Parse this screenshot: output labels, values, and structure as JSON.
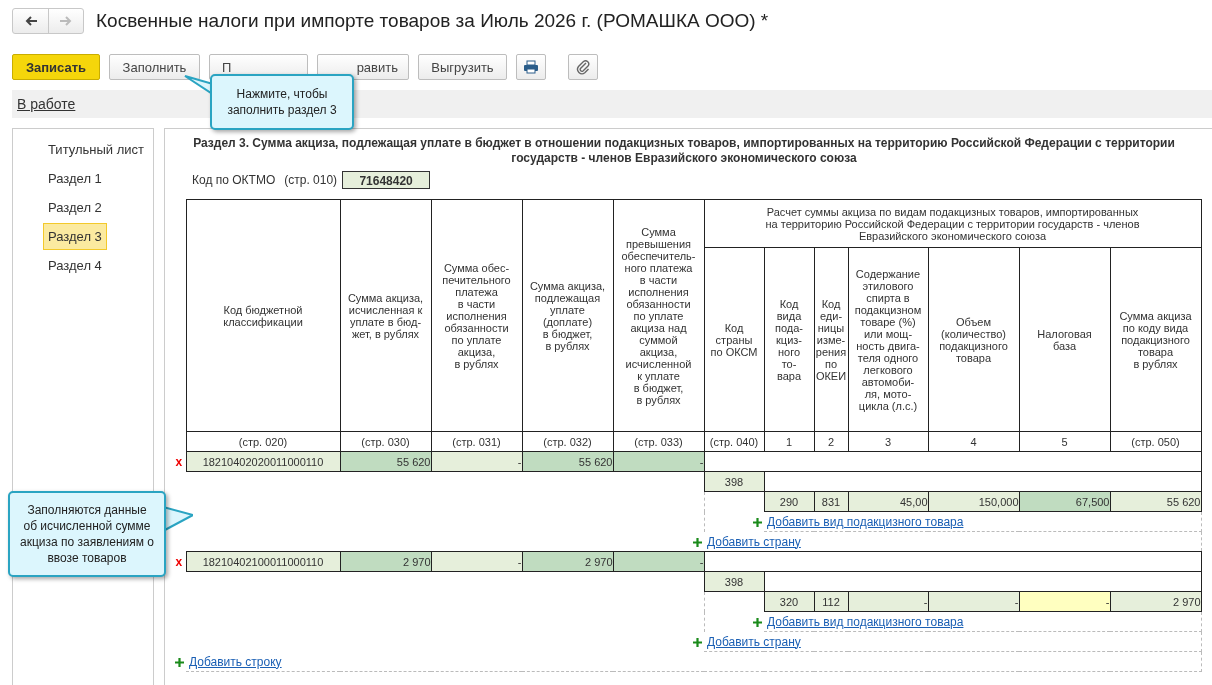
{
  "window": {
    "title": "Косвенные налоги при импорте товаров за Июль 2026 г. (РОМАШКА ООО) *"
  },
  "nav": [
    {
      "kind": "back",
      "disabled": false
    },
    {
      "kind": "forward",
      "disabled": true
    }
  ],
  "toolbar": [
    {
      "kind": "primary",
      "label": "Записать"
    },
    {
      "kind": "text",
      "label": "Заполнить"
    },
    {
      "kind": "text",
      "label": "П"
    },
    {
      "kind": "text",
      "label": "равить"
    },
    {
      "kind": "text",
      "label": "Выгрузить"
    },
    {
      "kind": "print"
    },
    {
      "kind": "attach"
    }
  ],
  "status": "В работе",
  "sidebar": {
    "items": [
      {
        "label": "Титульный лист",
        "selected": false
      },
      {
        "label": "Раздел 1",
        "selected": false
      },
      {
        "label": "Раздел 2",
        "selected": false
      },
      {
        "label": "Раздел 3",
        "selected": true
      },
      {
        "label": "Раздел 4",
        "selected": false
      }
    ]
  },
  "form": {
    "title": "Раздел 3. Сумма акциза, подлежащая уплате в бюджет в отношении подакцизных товаров, импортированных на территорию Российской Федерации с территории\nгосударств - членов Евразийского экономического союза",
    "oktmo": {
      "label": "Код по ОКТМО",
      "line": "(стр. 010)",
      "value": "71648420"
    },
    "group_header": "Расчет суммы акциза по видам подакцизных товаров, импортированных\nна территорию Российской Федерации с территории государств - членов\nЕвразийского экономического союза",
    "columns": [
      {
        "header": "Код бюджетной\nклассификации",
        "code": "(стр. 020)"
      },
      {
        "header": "Сумма акциза,\nисчисленная к\nуплате в бюд-\nжет, в рублях",
        "code": "(стр. 030)"
      },
      {
        "header": "Сумма обес-\nпечительного\nплатежа\nв части\nисполнения\nобязанности\nпо уплате\nакциза,\nв рублях",
        "code": "(стр. 031)"
      },
      {
        "header": "Сумма акциза,\nподлежащая\nуплате\n(доплате)\nв бюджет,\nв рублях",
        "code": "(стр. 032)"
      },
      {
        "header": "Сумма\nпревышения\nобеспечитель-\nного платежа\nв части\nисполнения\nобязанности\nпо уплате\nакциза над\nсуммой\nакциза,\nисчисленной\nк уплате\nв бюджет,\nв рублях",
        "code": "(стр. 033)"
      },
      {
        "header": "Код\nстраны\nпо ОКСМ",
        "code": "(стр. 040)"
      },
      {
        "header": "Код\nвида\nпода-\nкциз-\nного\nто-\nвара",
        "code": "1"
      },
      {
        "header": "Код\nеди-\nницы\nизме-\nрения\nпо\nОКЕИ",
        "code": "2"
      },
      {
        "header": "Содержание\nэтилового\nспирта в\nподакцизном\nтоваре (%)\nили мощ-\nность двига-\nтеля одного\nлегкового\nавтомоби-\nля, мото-\nцикла (л.с.)",
        "code": "3"
      },
      {
        "header": "Объем\n(количество)\nподакцизного\nтовара",
        "code": "4"
      },
      {
        "header": "Налоговая\nбаза",
        "code": "5"
      },
      {
        "header": "Сумма акциза\nпо коду вида\nподакцизного\nтовара\nв рублях",
        "code": "(стр. 050)"
      }
    ],
    "rows": [
      {
        "remove": "x",
        "cells": [
          {
            "value": "18210402020011000110",
            "color": "#e6efdb"
          },
          {
            "value": "55 620",
            "color": "#c0dcc0"
          },
          {
            "value": "-",
            "color": "#e6efdb"
          },
          {
            "value": "55 620",
            "color": "#c0dcc0"
          },
          {
            "value": "-",
            "color": "#c0dcc0"
          }
        ],
        "countries": [
          {
            "code": {
              "value": "398",
              "color": "#e6efdb"
            },
            "items": [
              {
                "cells": [
                  {
                    "value": "290",
                    "color": "#e6efdb"
                  },
                  {
                    "value": "831",
                    "color": "#e6efdb"
                  },
                  {
                    "value": "45,00",
                    "color": "#e6efdb"
                  },
                  {
                    "value": "150,000",
                    "color": "#e6efdb"
                  },
                  {
                    "value": "67,500",
                    "color": "#c0dcc0"
                  },
                  {
                    "value": "55 620",
                    "color": "#e6efdb"
                  }
                ]
              }
            ],
            "add_item": "Добавить вид подакцизного товара"
          }
        ],
        "add_country": "Добавить страну"
      },
      {
        "remove": "x",
        "cells": [
          {
            "value": "18210402100011000110",
            "color": "#e6efdb"
          },
          {
            "value": "2 970",
            "color": "#c0dcc0"
          },
          {
            "value": "-",
            "color": "#e6efdb"
          },
          {
            "value": "2 970",
            "color": "#c0dcc0"
          },
          {
            "value": "-",
            "color": "#c0dcc0"
          }
        ],
        "countries": [
          {
            "code": {
              "value": "398",
              "color": "#e6efdb"
            },
            "items": [
              {
                "cells": [
                  {
                    "value": "320",
                    "color": "#e6efdb"
                  },
                  {
                    "value": "112",
                    "color": "#e6efdb"
                  },
                  {
                    "value": "-",
                    "color": "#e6efdb"
                  },
                  {
                    "value": "-",
                    "color": "#e6efdb"
                  },
                  {
                    "value": "-",
                    "color": "#ffffc0"
                  },
                  {
                    "value": "2 970",
                    "color": "#e6efdb"
                  }
                ]
              }
            ],
            "add_item": "Добавить вид подакцизного товара"
          }
        ],
        "add_country": "Добавить страну"
      }
    ],
    "add_row": "Добавить строку"
  },
  "callouts": [
    {
      "kind": "top",
      "text": "Нажмите, чтобы\nзаполнить раздел 3"
    },
    {
      "kind": "left",
      "text": "Заполняются данные\nоб исчисленной сумме\nакциза по заявлениям о\nввозе товаров"
    }
  ]
}
